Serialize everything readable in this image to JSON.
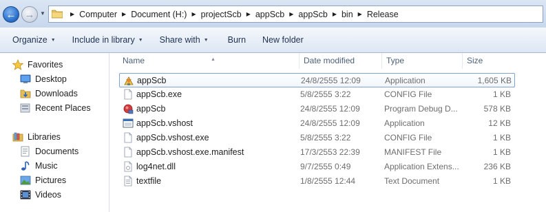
{
  "address": {
    "crumbs": [
      "Computer",
      "Document (H:)",
      "projectScb",
      "appScb",
      "appScb",
      "bin",
      "Release"
    ]
  },
  "toolbar": {
    "organize": "Organize",
    "include_in_library": "Include in library",
    "share_with": "Share with",
    "burn": "Burn",
    "new_folder": "New folder"
  },
  "nav": {
    "favorites": "Favorites",
    "desktop": "Desktop",
    "downloads": "Downloads",
    "recent_places": "Recent Places",
    "libraries": "Libraries",
    "documents": "Documents",
    "music": "Music",
    "pictures": "Pictures",
    "videos": "Videos"
  },
  "columns": {
    "name": "Name",
    "date_modified": "Date modified",
    "type": "Type",
    "size": "Size"
  },
  "files": [
    {
      "name": "appScb",
      "date": "24/8/2555 12:09",
      "type": "Application",
      "size": "1,605 KB",
      "icon": "app-scb-icon",
      "selected": true
    },
    {
      "name": "appScb.exe",
      "date": "5/8/2555 3:22",
      "type": "CONFIG File",
      "size": "1 KB",
      "icon": "config-file-icon",
      "selected": false
    },
    {
      "name": "appScb",
      "date": "24/8/2555 12:09",
      "type": "Program Debug D...",
      "size": "578 KB",
      "icon": "debug-database-icon",
      "selected": false
    },
    {
      "name": "appScb.vshost",
      "date": "24/8/2555 12:09",
      "type": "Application",
      "size": "12 KB",
      "icon": "window-app-icon",
      "selected": false
    },
    {
      "name": "appScb.vshost.exe",
      "date": "5/8/2555 3:22",
      "type": "CONFIG File",
      "size": "1 KB",
      "icon": "config-file-icon",
      "selected": false
    },
    {
      "name": "appScb.vshost.exe.manifest",
      "date": "17/3/2553 22:39",
      "type": "MANIFEST File",
      "size": "1 KB",
      "icon": "blank-file-icon",
      "selected": false
    },
    {
      "name": "log4net.dll",
      "date": "9/7/2555 0:49",
      "type": "Application Extens...",
      "size": "236 KB",
      "icon": "dll-file-icon",
      "selected": false
    },
    {
      "name": "textfile",
      "date": "1/8/2555 12:44",
      "type": "Text Document",
      "size": "1 KB",
      "icon": "text-file-icon",
      "selected": false
    }
  ]
}
